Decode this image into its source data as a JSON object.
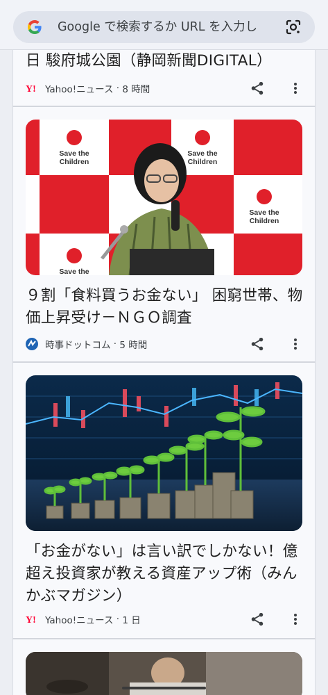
{
  "search": {
    "placeholder": "Google で検索するか URL を入力し"
  },
  "cards": [
    {
      "title": "日 駿府城公園（静岡新聞DIGITAL）",
      "source": "Yahoo!ニュース",
      "time": "8 時間"
    },
    {
      "title": "９割「食料買うお金ない」 困窮世帯、物価上昇受け－ＮＧＯ調査",
      "source": "時事ドットコム",
      "time": "5 時間",
      "image_text": "Save the Children"
    },
    {
      "title": "「お金がない」は言い訳でしかない！億超え投資家が教える資産アップ術（みんかぶマガジン）",
      "source": "Yahoo!ニュース",
      "time": "1 日"
    }
  ],
  "colors": {
    "save_red": "#e0202a",
    "yahoo_red": "#ff0033",
    "jiji_blue": "#1f64b4"
  }
}
